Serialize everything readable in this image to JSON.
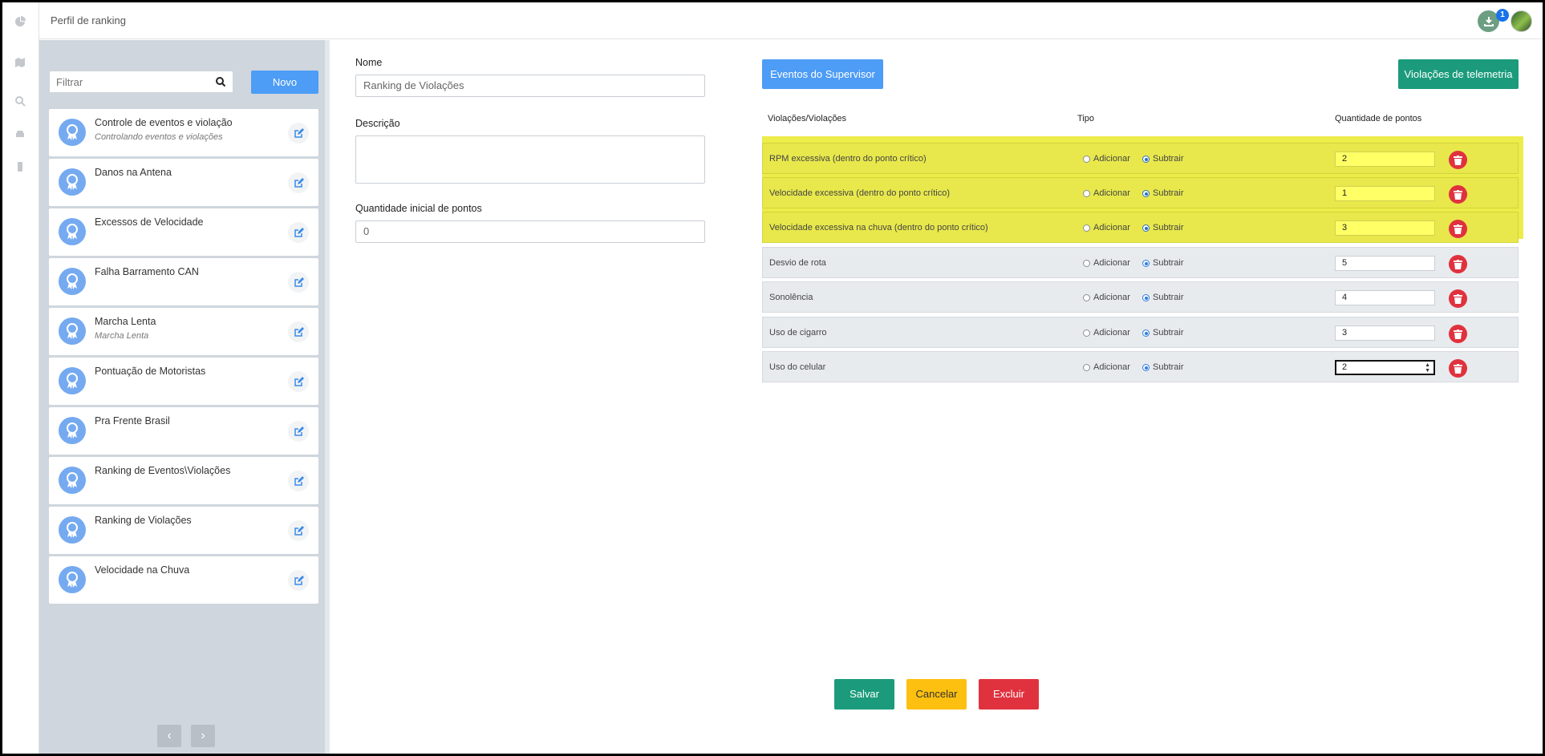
{
  "header": {
    "title": "Perfil de ranking",
    "download_count": "1"
  },
  "rail": {
    "icons": [
      "dashboard-icon",
      "map-icon",
      "search-icon",
      "car-icon",
      "mobile-icon"
    ]
  },
  "list": {
    "filter_placeholder": "Filtrar",
    "new_label": "Novo",
    "items": [
      {
        "title": "Controle de eventos e violação",
        "subtitle": "Controlando eventos e violações"
      },
      {
        "title": "Danos na Antena",
        "subtitle": ""
      },
      {
        "title": "Excessos de Velocidade",
        "subtitle": ""
      },
      {
        "title": "Falha Barramento CAN",
        "subtitle": ""
      },
      {
        "title": "Marcha Lenta",
        "subtitle": "Marcha Lenta"
      },
      {
        "title": "Pontuação de Motoristas",
        "subtitle": ""
      },
      {
        "title": "Pra Frente Brasil",
        "subtitle": ""
      },
      {
        "title": "Ranking de Eventos\\Violações",
        "subtitle": ""
      },
      {
        "title": "Ranking de Violações",
        "subtitle": ""
      },
      {
        "title": "Velocidade na Chuva",
        "subtitle": ""
      }
    ],
    "prev_label": "‹",
    "next_label": "›"
  },
  "form": {
    "name_label": "Nome",
    "name_value": "Ranking de Violações",
    "description_label": "Descrição",
    "description_value": "",
    "initial_points_label": "Quantidade inicial de pontos",
    "initial_points_value": "0"
  },
  "table": {
    "supervisor_events_label": "Eventos do Supervisor",
    "telemetry_label": "Violações de telemetria",
    "headers": {
      "name": "Violações/Violações",
      "type": "Tipo",
      "points": "Quantidade de pontos"
    },
    "add_label": "Adicionar",
    "subtract_label": "Subtrair",
    "rows": [
      {
        "name": "RPM excessiva (dentro do ponto crítico)",
        "type": "Subtrair",
        "points": "2",
        "highlighted": true
      },
      {
        "name": "Velocidade excessiva (dentro do ponto crítico)",
        "type": "Subtrair",
        "points": "1",
        "highlighted": true
      },
      {
        "name": "Velocidade excessiva na chuva (dentro do ponto crítico)",
        "type": "Subtrair",
        "points": "3",
        "highlighted": true
      },
      {
        "name": "Desvio de rota",
        "type": "Subtrair",
        "points": "5",
        "highlighted": false
      },
      {
        "name": "Sonolência",
        "type": "Subtrair",
        "points": "4",
        "highlighted": false
      },
      {
        "name": "Uso de cigarro",
        "type": "Subtrair",
        "points": "3",
        "highlighted": false
      },
      {
        "name": "Uso do celular",
        "type": "Subtrair",
        "points": "2",
        "highlighted": false
      }
    ]
  },
  "actions": {
    "save": "Salvar",
    "cancel": "Cancelar",
    "delete": "Excluir"
  },
  "colors": {
    "primary": "#4d9cf5",
    "success": "#1b9b7b",
    "warning": "#fdc010",
    "danger": "#e0323e",
    "highlight": "#ecec4a"
  }
}
